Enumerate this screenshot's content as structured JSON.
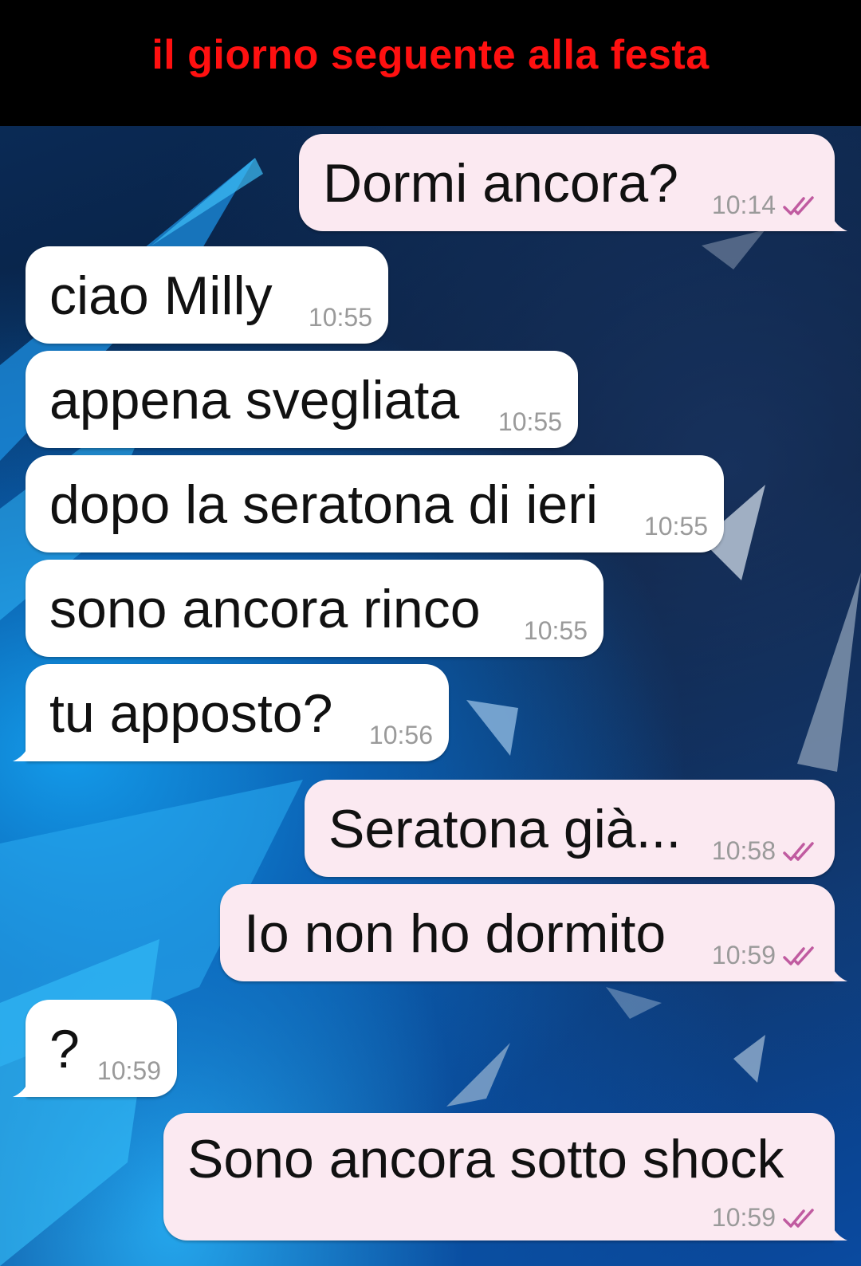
{
  "header": {
    "title": "il giorno seguente alla festa"
  },
  "theme": {
    "header_title_color": "#ff1010",
    "outgoing_bubble": "#fbe9f1",
    "incoming_bubble": "#ffffff",
    "read_ticks_color": "#c05ba0"
  },
  "messages": [
    {
      "direction": "out",
      "text": "Dormi ancora?",
      "time": "10:14",
      "status": "read"
    },
    {
      "direction": "in",
      "text": "ciao Milly",
      "time": "10:55"
    },
    {
      "direction": "in",
      "text": "appena svegliata",
      "time": "10:55"
    },
    {
      "direction": "in",
      "text": "dopo la seratona di ieri",
      "time": "10:55"
    },
    {
      "direction": "in",
      "text": "sono ancora rinco",
      "time": "10:55"
    },
    {
      "direction": "in",
      "text": "tu apposto?",
      "time": "10:56"
    },
    {
      "direction": "out",
      "text": "Seratona già...",
      "time": "10:58",
      "status": "read"
    },
    {
      "direction": "out",
      "text": "Io non ho dormito",
      "time": "10:59",
      "status": "read"
    },
    {
      "direction": "in",
      "text": "?",
      "time": "10:59"
    },
    {
      "direction": "out",
      "text": "Sono ancora sotto shock",
      "time": "10:59",
      "status": "read"
    }
  ]
}
